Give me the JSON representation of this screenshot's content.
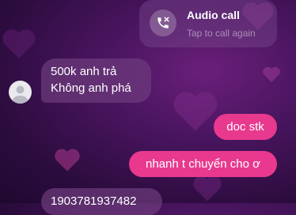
{
  "call": {
    "title": "Audio call",
    "subtitle": "Tap to call again",
    "icon": "missed-call-phone-icon"
  },
  "messages_in": [
    {
      "lines": [
        "500k anh trả",
        "Không anh phá"
      ]
    },
    {
      "lines": [
        "1903781937482"
      ]
    }
  ],
  "messages_out": [
    {
      "text": "doc stk"
    },
    {
      "text": "nhanh t chuyển cho ơ"
    }
  ],
  "colors": {
    "background": "#3a0f50",
    "outgoing_bubble": "#e8398e",
    "incoming_bubble": "#6e3c7d"
  }
}
